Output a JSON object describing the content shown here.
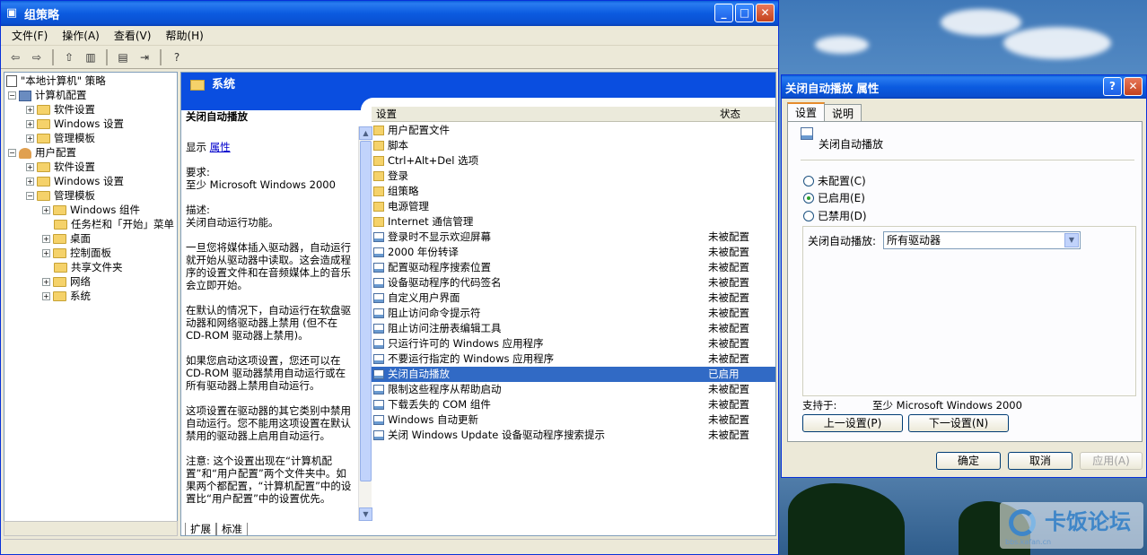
{
  "main_window": {
    "title": "组策略",
    "menu": [
      "文件(F)",
      "操作(A)",
      "查看(V)",
      "帮助(H)"
    ]
  },
  "tree": {
    "root": "\"本地计算机\" 策略",
    "computer_config": "计算机配置",
    "cc_software": "软件设置",
    "cc_windows": "Windows 设置",
    "cc_admin": "管理模板",
    "user_config": "用户配置",
    "uc_software": "软件设置",
    "uc_windows": "Windows 设置",
    "uc_admin": "管理模板",
    "uc_components": "Windows 组件",
    "uc_taskbar": "任务栏和「开始」菜单",
    "uc_desktop": "桌面",
    "uc_control": "控制面板",
    "uc_shared": "共享文件夹",
    "uc_network": "网络",
    "uc_system": "系统"
  },
  "right_pane": {
    "header": "系统",
    "desc_title": "关闭自动播放",
    "display_label": "显示",
    "properties_link": "属性",
    "req_label": "要求:",
    "req_value": "至少 Microsoft Windows 2000",
    "desc_label": "描述:",
    "desc_line": "关闭自动运行功能。",
    "para1": "一旦您将媒体插入驱动器，自动运行就开始从驱动器中读取。这会造成程序的设置文件和在音频媒体上的音乐会立即开始。",
    "para2": "在默认的情况下，自动运行在软盘驱动器和网络驱动器上禁用 (但不在 CD-ROM 驱动器上禁用)。",
    "para3": "如果您启动这项设置，您还可以在 CD-ROM 驱动器禁用自动运行或在所有驱动器上禁用自动运行。",
    "para4": "这项设置在驱动器的其它类别中禁用自动运行。您不能用这项设置在默认禁用的驱动器上启用自动运行。",
    "para5": "注意: 这个设置出现在“计算机配置”和“用户配置”两个文件夹中。如果两个都配置，“计算机配置”中的设置比“用户配置”中的设置优先。",
    "col_setting": "设置",
    "col_state": "状态",
    "rows": [
      {
        "name": "用户配置文件",
        "state": "",
        "type": "folder"
      },
      {
        "name": "脚本",
        "state": "",
        "type": "folder"
      },
      {
        "name": "Ctrl+Alt+Del 选项",
        "state": "",
        "type": "folder"
      },
      {
        "name": "登录",
        "state": "",
        "type": "folder"
      },
      {
        "name": "组策略",
        "state": "",
        "type": "folder"
      },
      {
        "name": "电源管理",
        "state": "",
        "type": "folder"
      },
      {
        "name": "Internet 通信管理",
        "state": "",
        "type": "folder"
      },
      {
        "name": "登录时不显示欢迎屏幕",
        "state": "未被配置",
        "type": "setting"
      },
      {
        "name": "2000 年份转译",
        "state": "未被配置",
        "type": "setting"
      },
      {
        "name": "配置驱动程序搜索位置",
        "state": "未被配置",
        "type": "setting"
      },
      {
        "name": "设备驱动程序的代码签名",
        "state": "未被配置",
        "type": "setting"
      },
      {
        "name": "自定义用户界面",
        "state": "未被配置",
        "type": "setting"
      },
      {
        "name": "阻止访问命令提示符",
        "state": "未被配置",
        "type": "setting"
      },
      {
        "name": "阻止访问注册表编辑工具",
        "state": "未被配置",
        "type": "setting"
      },
      {
        "name": "只运行许可的 Windows 应用程序",
        "state": "未被配置",
        "type": "setting"
      },
      {
        "name": "不要运行指定的 Windows 应用程序",
        "state": "未被配置",
        "type": "setting"
      },
      {
        "name": "关闭自动播放",
        "state": "已启用",
        "type": "setting",
        "selected": true
      },
      {
        "name": "限制这些程序从帮助启动",
        "state": "未被配置",
        "type": "setting"
      },
      {
        "name": "下载丢失的 COM 组件",
        "state": "未被配置",
        "type": "setting"
      },
      {
        "name": "Windows 自动更新",
        "state": "未被配置",
        "type": "setting"
      },
      {
        "name": "关闭 Windows Update 设备驱动程序搜索提示",
        "state": "未被配置",
        "type": "setting"
      }
    ],
    "tab_extended": "扩展",
    "tab_standard": "标准"
  },
  "dialog": {
    "title": "关闭自动播放 属性",
    "help_btn": "?",
    "tab_settings": "设置",
    "tab_explain": "说明",
    "setting_name": "关闭自动播放",
    "radio_not_configured": "未配置(C)",
    "radio_enabled": "已启用(E)",
    "radio_disabled": "已禁用(D)",
    "combo_label": "关闭自动播放:",
    "combo_value": "所有驱动器",
    "supported_label": "支持于:",
    "supported_value": "至少 Microsoft Windows 2000",
    "prev_btn": "上一设置(P)",
    "next_btn": "下一设置(N)",
    "ok_btn": "确定",
    "cancel_btn": "取消",
    "apply_btn": "应用(A)"
  },
  "watermark": {
    "text": "卡饭论坛",
    "sub": "bbs.kafan.cn"
  }
}
